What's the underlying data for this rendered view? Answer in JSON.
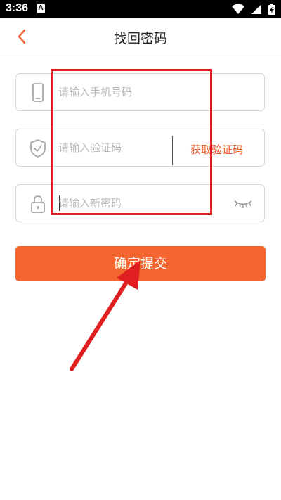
{
  "status_bar": {
    "time": "3:36",
    "notification_letter": "A",
    "icons": [
      "wifi-icon",
      "signal-icon",
      "battery-charging-icon"
    ]
  },
  "header": {
    "title": "找回密码",
    "back_icon": "chevron-left-icon"
  },
  "form": {
    "phone": {
      "icon": "phone-icon",
      "placeholder": "请输入手机号码",
      "value": ""
    },
    "code": {
      "icon": "shield-check-icon",
      "placeholder": "请输入验证码",
      "value": "",
      "get_code_label": "获取验证码"
    },
    "password": {
      "icon": "lock-icon",
      "placeholder": "请输入新密码",
      "value": "",
      "toggle_icon": "eye-closed-icon"
    }
  },
  "submit_label": "确定提交",
  "colors": {
    "accent": "#f4652f",
    "link": "#f05a28",
    "annotation": "#e02020"
  }
}
